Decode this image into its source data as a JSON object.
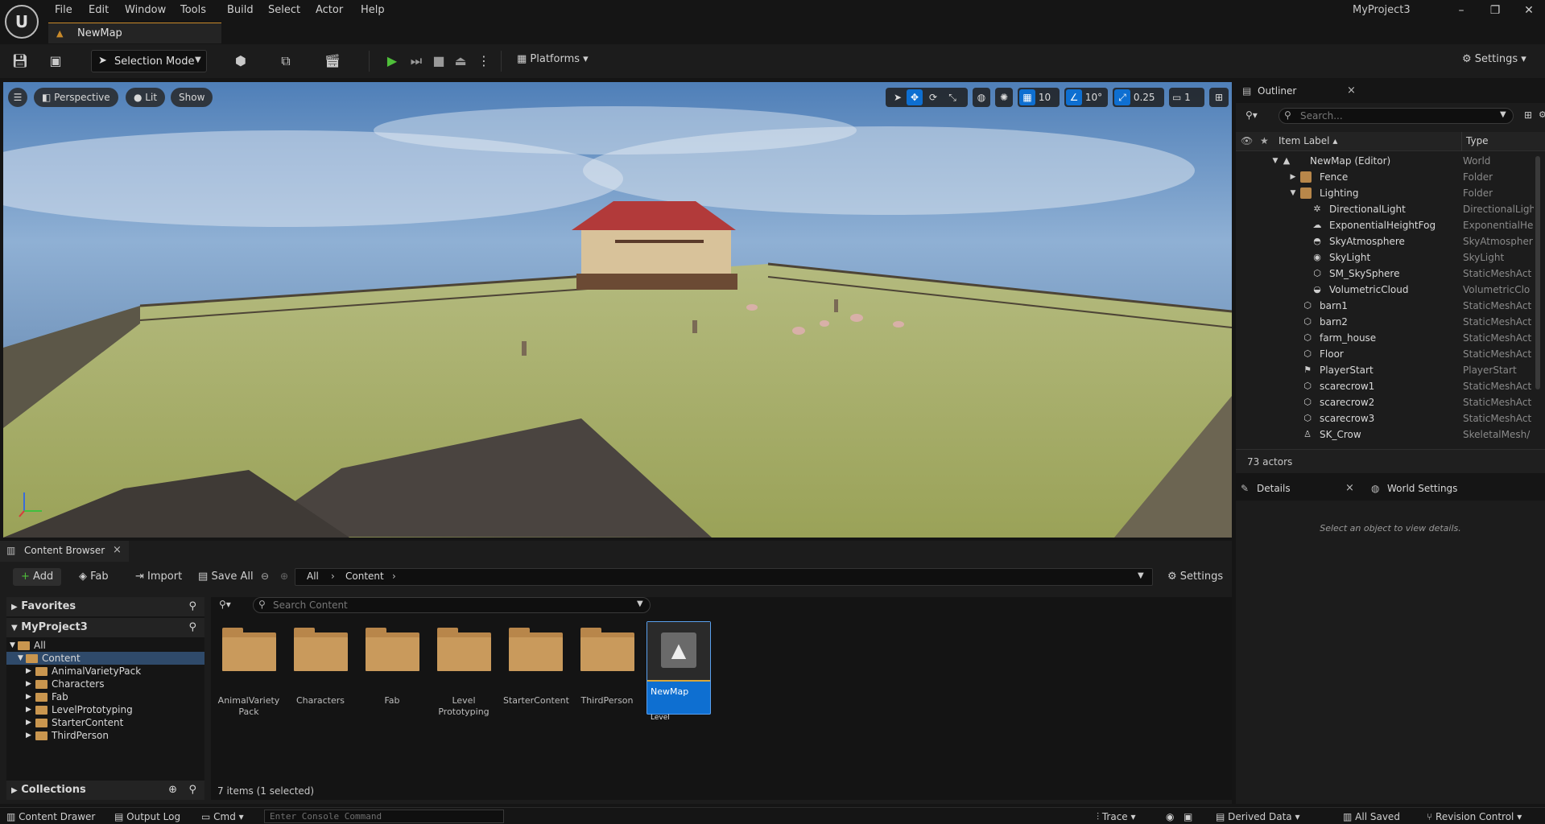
{
  "menu": [
    "File",
    "Edit",
    "Window",
    "Tools",
    "Build",
    "Select",
    "Actor",
    "Help"
  ],
  "project_name": "MyProject3",
  "map_tab": "NewMap",
  "toolbar": {
    "selection_mode": "Selection Mode",
    "platforms": "Platforms",
    "settings": "Settings"
  },
  "viewport": {
    "perspective": "Perspective",
    "lit": "Lit",
    "show": "Show",
    "grid_snap": "10",
    "rotate_snap": "10°",
    "scale_snap": "0.25",
    "camera_speed": "1"
  },
  "outliner": {
    "title": "Outliner",
    "search_placeholder": "Search...",
    "col_label": "Item Label",
    "col_type": "Type",
    "rows": [
      {
        "label": "NewMap (Editor)",
        "type": "World"
      },
      {
        "label": "Fence",
        "type": "Folder"
      },
      {
        "label": "Lighting",
        "type": "Folder"
      },
      {
        "label": "DirectionalLight",
        "type": "DirectionalLigh"
      },
      {
        "label": "ExponentialHeightFog",
        "type": "ExponentialHe"
      },
      {
        "label": "SkyAtmosphere",
        "type": "SkyAtmospher"
      },
      {
        "label": "SkyLight",
        "type": "SkyLight"
      },
      {
        "label": "SM_SkySphere",
        "type": "StaticMeshAct"
      },
      {
        "label": "VolumetricCloud",
        "type": "VolumetricClo"
      },
      {
        "label": "barn1",
        "type": "StaticMeshAct"
      },
      {
        "label": "barn2",
        "type": "StaticMeshAct"
      },
      {
        "label": "farm_house",
        "type": "StaticMeshAct"
      },
      {
        "label": "Floor",
        "type": "StaticMeshAct"
      },
      {
        "label": "PlayerStart",
        "type": "PlayerStart"
      },
      {
        "label": "scarecrow1",
        "type": "StaticMeshAct"
      },
      {
        "label": "scarecrow2",
        "type": "StaticMeshAct"
      },
      {
        "label": "scarecrow3",
        "type": "StaticMeshAct"
      },
      {
        "label": "SK_Crow",
        "type": "SkeletalMesh/"
      }
    ],
    "actor_count": "73 actors"
  },
  "details": {
    "tab_details": "Details",
    "tab_world_settings": "World Settings",
    "empty_text": "Select an object to view details."
  },
  "content_browser": {
    "tab": "Content Browser",
    "add": "Add",
    "fab": "Fab",
    "import": "Import",
    "save_all": "Save All",
    "path": [
      "All",
      "Content"
    ],
    "settings": "Settings",
    "favorites": "Favorites",
    "project": "MyProject3",
    "tree": [
      "All",
      "Content",
      "AnimalVarietyPack",
      "Characters",
      "Fab",
      "LevelPrototyping",
      "StarterContent",
      "ThirdPerson"
    ],
    "collections": "Collections",
    "search_placeholder": "Search Content",
    "items": [
      {
        "name": "AnimalVariety\nPack"
      },
      {
        "name": "Characters"
      },
      {
        "name": "Fab"
      },
      {
        "name": "Level\nPrototyping"
      },
      {
        "name": "StarterContent"
      },
      {
        "name": "ThirdPerson"
      }
    ],
    "selected_item": {
      "name": "NewMap",
      "kind": "Level"
    },
    "item_count": "7 items (1 selected)"
  },
  "statusbar": {
    "content_drawer": "Content Drawer",
    "output_log": "Output Log",
    "cmd": "Cmd",
    "console_placeholder": "Enter Console Command",
    "trace": "Trace",
    "derived_data": "Derived Data",
    "all_saved": "All Saved",
    "revision_control": "Revision Control"
  }
}
